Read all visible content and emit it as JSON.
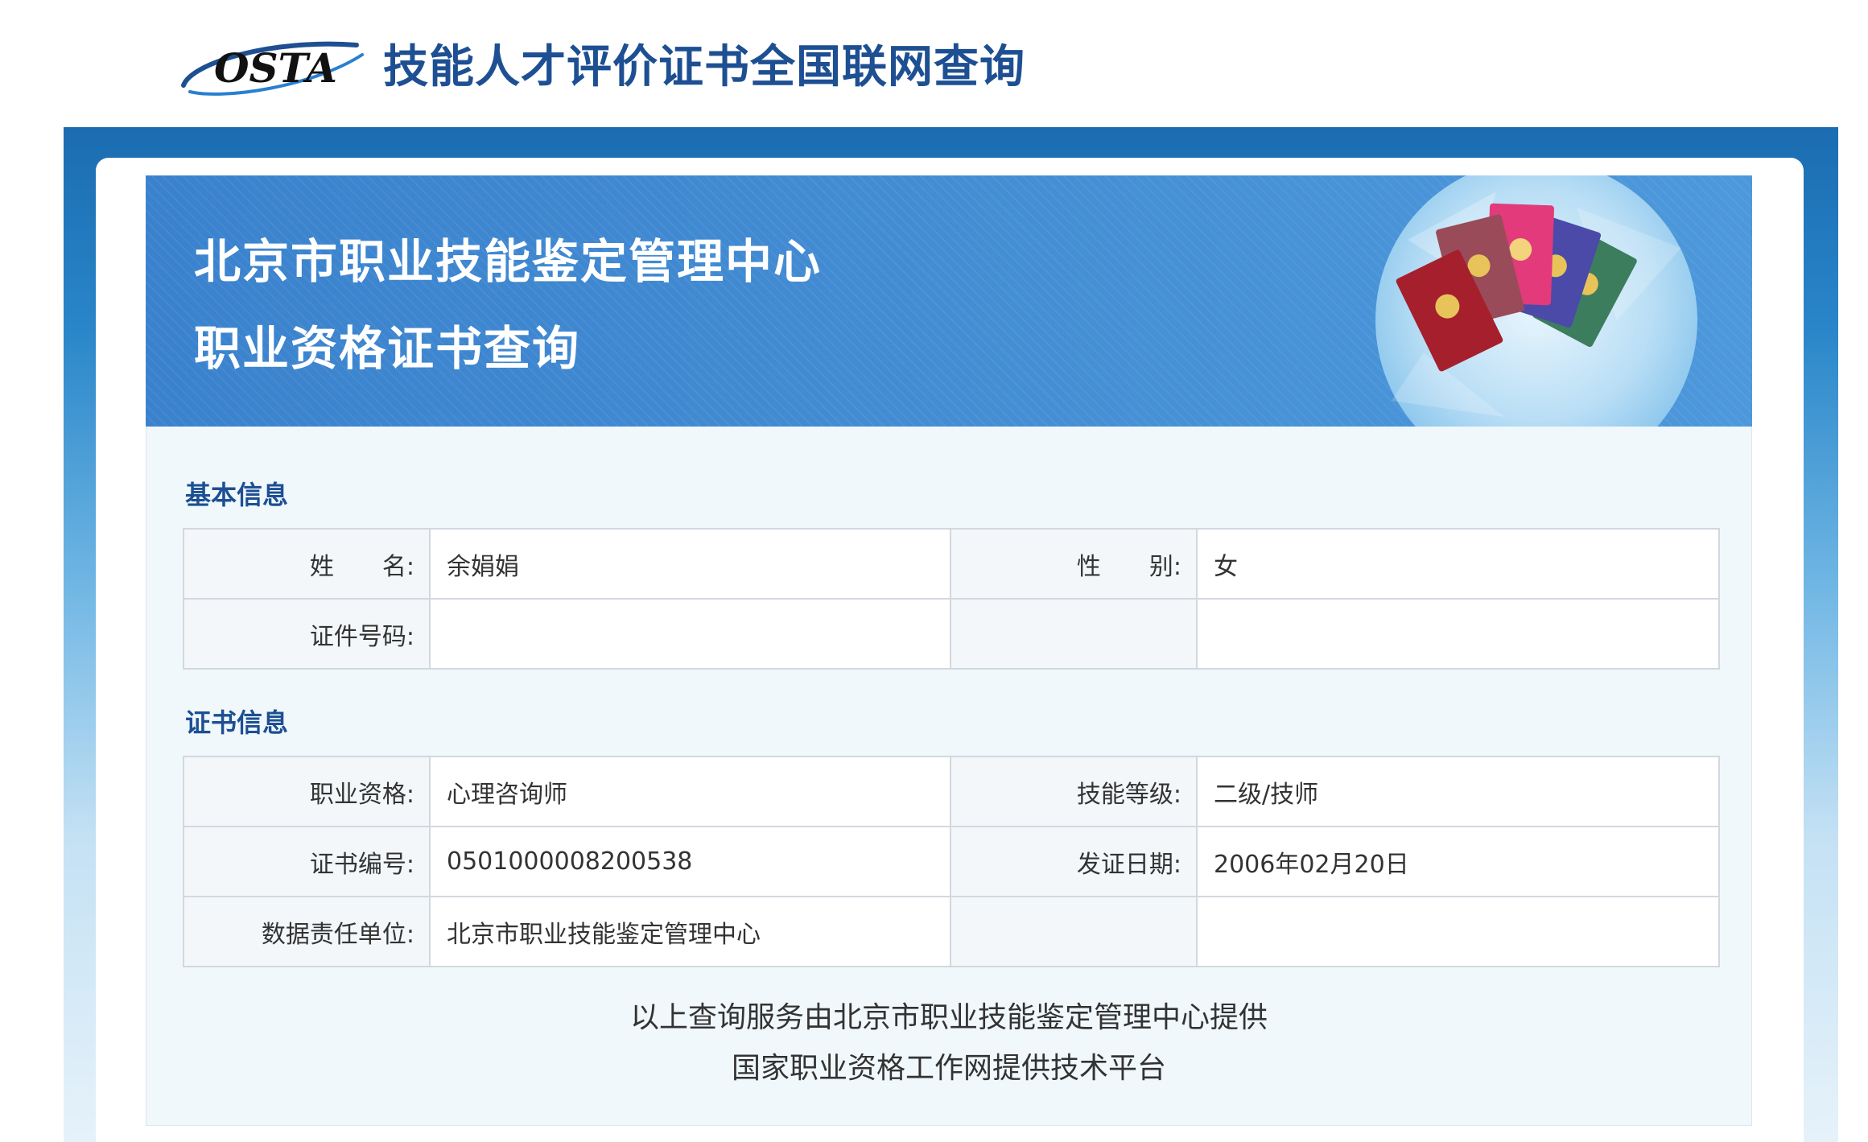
{
  "header": {
    "logo_text": "OSTA",
    "site_title": "技能人才评价证书全国联网查询"
  },
  "banner": {
    "line1": "北京市职业技能鉴定管理中心",
    "line2": "职业资格证书查询"
  },
  "basic_info": {
    "section_title": "基本信息",
    "name_label": "姓　　名:",
    "name_value": "余娟娟",
    "gender_label": "性　　别:",
    "gender_value": "女",
    "id_label": "证件号码:",
    "id_value": ""
  },
  "cert_info": {
    "section_title": "证书信息",
    "qualification_label": "职业资格:",
    "qualification_value": "心理咨询师",
    "skill_level_label": "技能等级:",
    "skill_level_value": "二级/技师",
    "cert_no_label": "证书编号:",
    "cert_no_value": "0501000008200538",
    "issue_date_label": "发证日期:",
    "issue_date_value": "2006年02月20日",
    "unit_label": "数据责任单位:",
    "unit_value": "北京市职业技能鉴定管理中心"
  },
  "footer": {
    "line1": "以上查询服务由北京市职业技能鉴定管理中心提供",
    "line2": "国家职业资格工作网提供技术平台"
  },
  "colors": {
    "brand_blue": "#1d4f92",
    "banner_blue": "#3d8ad3",
    "content_bg": "#f0f8fc"
  }
}
